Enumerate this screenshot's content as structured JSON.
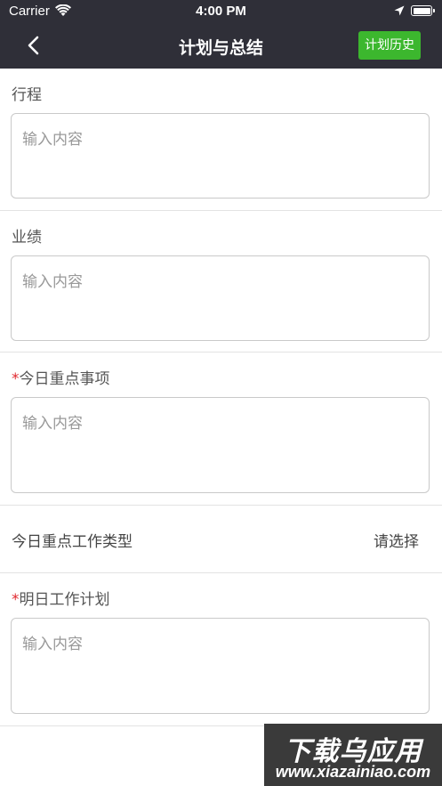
{
  "status_bar": {
    "carrier": "Carrier",
    "time": "4:00 PM"
  },
  "nav": {
    "title": "计划与总结",
    "history_button": "计划历史"
  },
  "form": {
    "itinerary": {
      "label": "行程",
      "placeholder": "输入内容"
    },
    "performance": {
      "label": "业绩",
      "placeholder": "输入内容"
    },
    "today_focus": {
      "required_mark": "*",
      "label": "今日重点事项",
      "placeholder": "输入内容"
    },
    "today_focus_type": {
      "label": "今日重点工作类型",
      "value": "请选择"
    },
    "tomorrow_plan": {
      "required_mark": "*",
      "label": "明日工作计划",
      "placeholder": "输入内容"
    }
  },
  "watermark": {
    "top": "下载乌应用",
    "bottom": "www.xiazainiao.com"
  },
  "colors": {
    "nav_bg": "#2f2f38",
    "accent_green": "#3cb72e",
    "required_red": "#e0282e"
  }
}
